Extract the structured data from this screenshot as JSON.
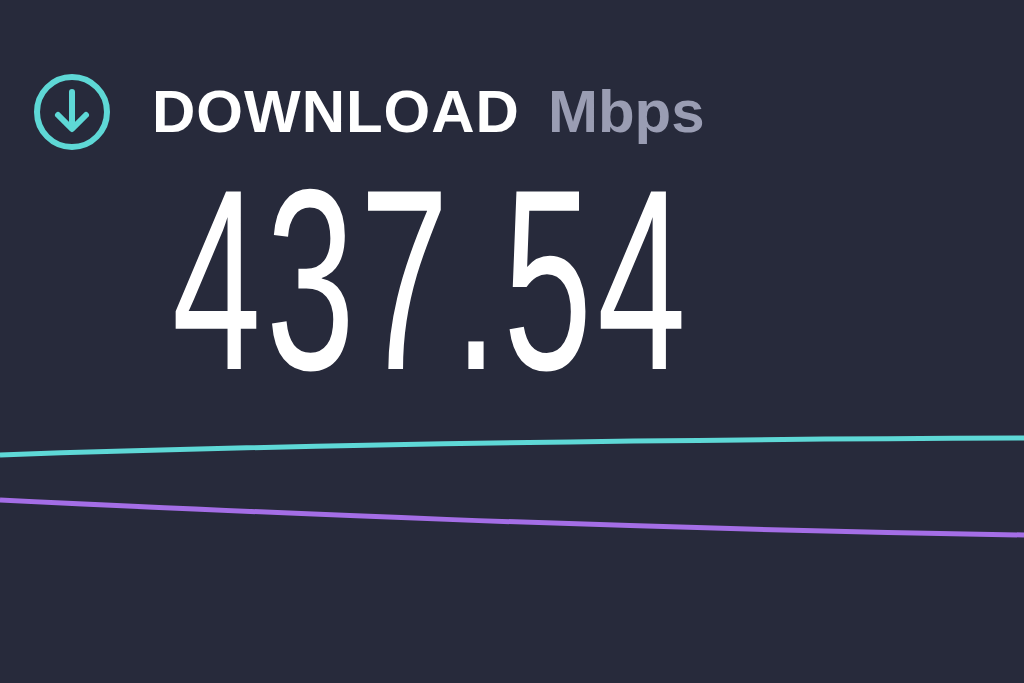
{
  "header": {
    "title": "DOWNLOAD",
    "unit": "Mbps"
  },
  "speed": "437.54"
}
